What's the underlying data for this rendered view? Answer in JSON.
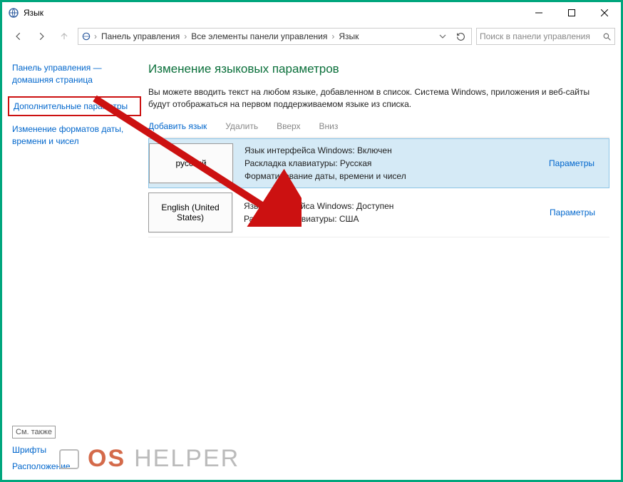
{
  "titlebar": {
    "title": "Язык"
  },
  "breadcrumbs": {
    "c1": "Панель управления",
    "c2": "Все элементы панели управления",
    "c3": "Язык"
  },
  "search": {
    "placeholder": "Поиск в панели управления"
  },
  "leftnav": {
    "home1": "Панель управления —",
    "home2": "домашняя страница",
    "advanced": "Дополнительные параметры",
    "formats1": "Изменение форматов даты,",
    "formats2": "времени и чисел",
    "see_also": "См. также",
    "fonts": "Шрифты",
    "location": "Расположение"
  },
  "main": {
    "title": "Изменение языковых параметров",
    "desc": "Вы можете вводить текст на любом языке, добавленном в список. Система Windows, приложения и веб-сайты будут отображаться на первом поддерживаемом языке из списка.",
    "tb_add": "Добавить язык",
    "tb_remove": "Удалить",
    "tb_up": "Вверх",
    "tb_down": "Вниз",
    "options": "Параметры"
  },
  "languages": [
    {
      "name": "русский",
      "selected": true,
      "line1": "Язык интерфейса Windows: Включен",
      "line2": "Раскладка клавиатуры: Русская",
      "line3": "Форматирование даты, времени и чисел"
    },
    {
      "name": "English (United States)",
      "selected": false,
      "line1": "Язык интерфейса Windows: Доступен",
      "line2": "Раскладка клавиатуры: США",
      "line3": ""
    }
  ],
  "watermark": {
    "os": "OS",
    "helper": "HELPER"
  }
}
